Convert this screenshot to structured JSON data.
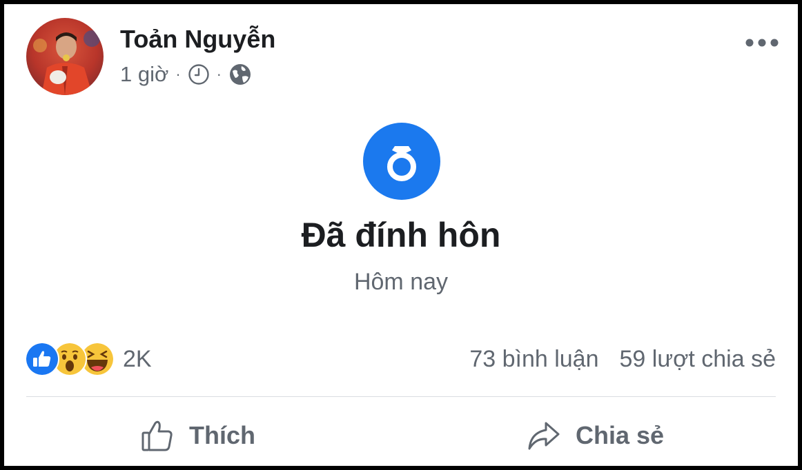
{
  "post": {
    "author": "Toản Nguyễn",
    "time": "1 giờ",
    "separator": "·",
    "icons": {
      "time_icon": "clock-icon",
      "audience_icon": "globe-icon",
      "more_icon": "more-options-icon",
      "event_icon": "ring-icon"
    },
    "life_event": {
      "title": "Đã đính hôn",
      "subtitle": "Hôm nay",
      "icon_color": "#1b79ee"
    },
    "reactions": {
      "types": [
        "like",
        "wow",
        "haha"
      ],
      "count": "2K"
    },
    "stats": {
      "comments": "73 bình luận",
      "shares": "59 lượt chia sẻ"
    },
    "actions": {
      "like_label": "Thích",
      "share_label": "Chia sẻ"
    }
  }
}
